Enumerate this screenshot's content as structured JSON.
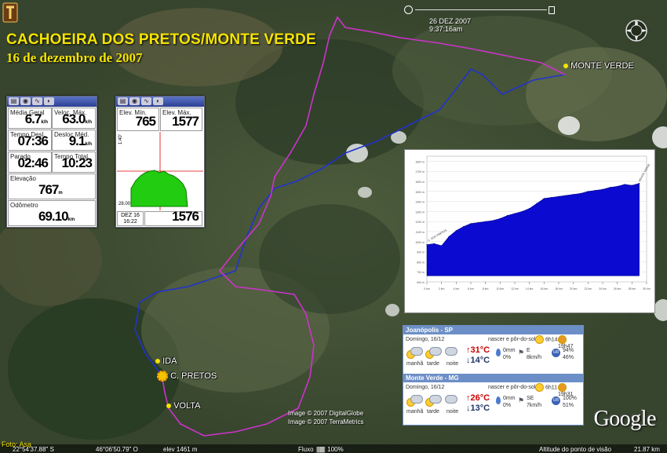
{
  "title": "CACHOEIRA DOS PRETOS/MONTE VERDE",
  "subtitle": "16 de dezembro de 2007",
  "datetime": {
    "date": "26 DEZ 2007",
    "time": "9:37:16am"
  },
  "compass_label": "N",
  "places": {
    "monte_verde": "MONTE VERDE",
    "ida": "IDA",
    "c_pretos": "C. PRETOS",
    "volta": "VOLTA"
  },
  "route_colors": {
    "ida": "#2233cc",
    "volta": "#cc33cc"
  },
  "gps_stats": [
    {
      "label": "Média Geral",
      "value": "6.7",
      "unit": "k/h"
    },
    {
      "label": "Veloc. Máx.",
      "value": "63.0",
      "unit": "k/h"
    },
    {
      "label": "Tempo Desl.",
      "value": "07:36",
      "unit": ""
    },
    {
      "label": "Desloc Méd.",
      "value": "9.1",
      "unit": "k/h"
    },
    {
      "label": "Parado",
      "value": "02:46",
      "unit": ""
    },
    {
      "label": "Tempo Total",
      "value": "10:23",
      "unit": ""
    },
    {
      "label": "Elevação",
      "value": "767",
      "unit": "m"
    },
    {
      "label": "Odômetro",
      "value": "69.10",
      "unit": "km"
    }
  ],
  "gps_elev": {
    "min_label": "Elev. Mín.",
    "min_value": "765",
    "max_label": "Elev. Máx.",
    "max_value": "1577",
    "scale_top": "1:40'",
    "scale_bottom": "28.00",
    "date": "DEZ 16",
    "time": "16:22",
    "current": "1576"
  },
  "elevation_profile": {
    "start_label": "C. DOS PRETOS",
    "end_label": "MONTE VERDE",
    "x_ticks": [
      "0 km",
      "2 km",
      "4 km",
      "6 km",
      "8 km",
      "10 km",
      "12 km",
      "14 km",
      "16 km",
      "18 km",
      "20 km",
      "22 km",
      "24 km",
      "26 km",
      "28 km",
      "30 km"
    ],
    "y_ticks": [
      "1800 m",
      "1700 m",
      "1600 m",
      "1500 m",
      "1400 m",
      "1300 m",
      "1200 m",
      "1100 m",
      "1000 m",
      "900 m",
      "800 m",
      "700 m",
      "600 m"
    ]
  },
  "chart_data": {
    "type": "area",
    "x": [
      0,
      1,
      2,
      3,
      4,
      5,
      6,
      7,
      8,
      9,
      10,
      11,
      12,
      13,
      14,
      15,
      16,
      17,
      18,
      19,
      20,
      21,
      22,
      23,
      24,
      25,
      26,
      27,
      28,
      29
    ],
    "series": [
      {
        "values": [
          970,
          980,
          960,
          1050,
          1110,
          1150,
          1180,
          1190,
          1200,
          1210,
          1230,
          1260,
          1280,
          1300,
          1330,
          1380,
          1430,
          1440,
          1450,
          1460,
          1470,
          1480,
          1500,
          1510,
          1520,
          1540,
          1550,
          1570,
          1560,
          1580
        ]
      }
    ],
    "ylim": [
      600,
      1850
    ],
    "xlim": [
      0,
      30
    ],
    "color": "#0a0ad0"
  },
  "weather": [
    {
      "city": "Joanópolis - SP",
      "date": "Domingo, 16/12",
      "sun_label": "nascer e pôr-do-sol:",
      "sunrise": "6h14",
      "sunset": "19h47",
      "periods": [
        "manhã",
        "tarde",
        "noite"
      ],
      "max": "31°C",
      "min": "14°C",
      "rain": "0mm",
      "rain_pct": "0%",
      "wind_dir": "E",
      "wind": "8km/h",
      "humidity_max": "94%",
      "humidity_min": "46%"
    },
    {
      "city": "Monte Verde - MG",
      "date": "Domingo, 16/12",
      "sun_label": "nascer e pôr-do-sol:",
      "sunrise": "6h11",
      "sunset": "19h31",
      "periods": [
        "manhã",
        "tarde",
        "noite"
      ],
      "max": "26°C",
      "min": "13°C",
      "rain": "0mm",
      "rain_pct": "0%",
      "wind_dir": "SE",
      "wind": "7km/h",
      "humidity_max": "100%",
      "humidity_min": "51%"
    }
  ],
  "credits": [
    "Image © 2007 DigitalGlobe",
    "Image © 2007 TerraMetrics"
  ],
  "statusbar": {
    "photo": "Foto: Asa",
    "lat": "22°54'37.88\" S",
    "lon": "46°06'50.79\" O",
    "elev": "elev 1461 m",
    "stream": "Fluxo",
    "stream_pct": "100%",
    "eye_label": "Altitude do ponto de visão",
    "eye_alt": "21.87 km"
  },
  "brand": "Google"
}
